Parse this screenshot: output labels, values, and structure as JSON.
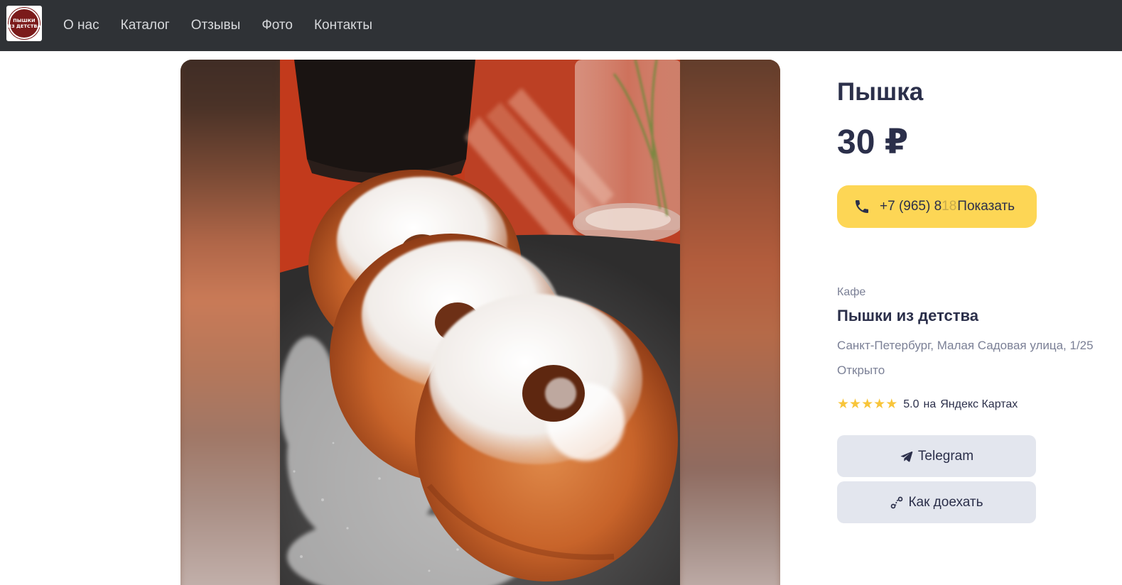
{
  "logo": {
    "line1": "ПЫШКИ",
    "line2": "ИЗ ДЕТСТВА",
    "color": "#7b1a1a"
  },
  "nav": {
    "items": [
      {
        "label": "О нас"
      },
      {
        "label": "Каталог"
      },
      {
        "label": "Отзывы"
      },
      {
        "label": "Фото"
      },
      {
        "label": "Контакты"
      }
    ]
  },
  "product": {
    "title": "Пышка",
    "price": "30 ₽",
    "image_icon": "donuts-photo"
  },
  "phone": {
    "visible_part": "+7 (965) 8",
    "hidden_part": "18",
    "show_label": "Показать",
    "icon": "phone-icon",
    "button_color": "#fdd655"
  },
  "place": {
    "type": "Кафе",
    "name": "Пышки из детства",
    "address": "Санкт-Петербург, Малая Садовая улица, 1/25",
    "status": "Открыто"
  },
  "rating": {
    "stars": 5,
    "max_stars": 5,
    "value": "5.0",
    "on_label": "на",
    "source": "Яндекс Картах",
    "star_color": "#f8c53a"
  },
  "actions": {
    "telegram_label": "Telegram",
    "telegram_icon": "paper-plane-icon",
    "route_label": "Как доехать",
    "route_icon": "route-icon"
  }
}
